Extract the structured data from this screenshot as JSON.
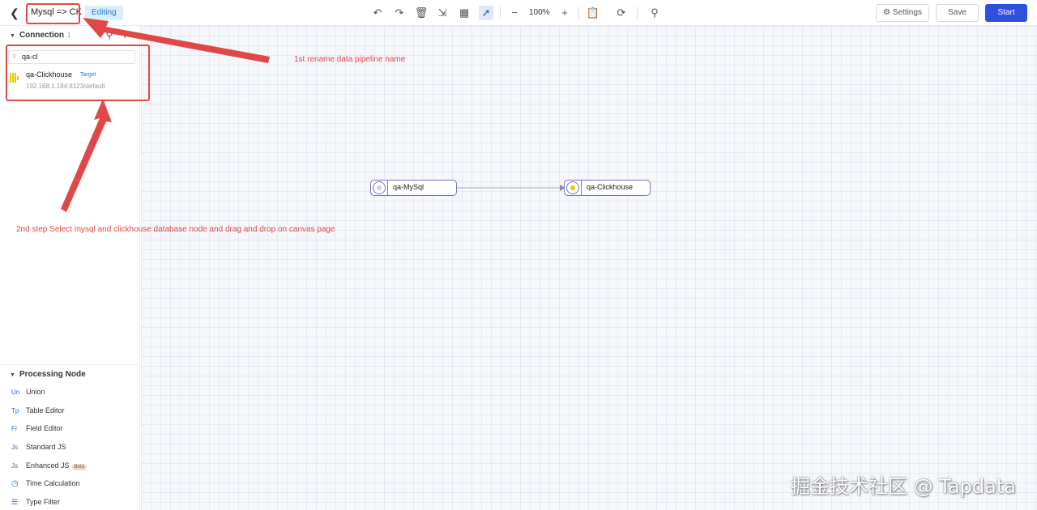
{
  "header": {
    "title": "Mysql => CK",
    "status": "Editing",
    "zoom": "100%",
    "settings_label": "Settings",
    "save_label": "Save",
    "start_label": "Start"
  },
  "sidebar": {
    "connection_heading": "Connection",
    "connection_count": "1",
    "search_value": "qa-cl",
    "connections": [
      {
        "name": "qa-Clickhouse",
        "tag": "Target",
        "address": "192.168.1.184:8123/default"
      }
    ],
    "processing_heading": "Processing Node",
    "processing_items": [
      {
        "icon": "Un",
        "label": "Union"
      },
      {
        "icon": "Tp",
        "label": "Table Editor"
      },
      {
        "icon": "Fr",
        "label": "Field Editor"
      },
      {
        "icon": "Js",
        "label": "Standard JS"
      },
      {
        "icon": "Js",
        "label": "Enhanced JS",
        "badge": "Beta"
      },
      {
        "icon": "clock-icon",
        "label": "Time Calculation"
      },
      {
        "icon": "filter-icon",
        "label": "Type Filter"
      }
    ]
  },
  "canvas": {
    "nodes": [
      {
        "label": "qa-MySql",
        "icon": "mysql-icon"
      },
      {
        "label": "qa-Clickhouse",
        "icon": "clickhouse-icon"
      }
    ]
  },
  "annotations": {
    "step1": "1st rename data pipeline name",
    "step2": "2nd step Select mysql and clickhouse database node and drag and drop on canvas page"
  },
  "watermark": "掘金技术社区 @ Tapdata",
  "colors": {
    "accent": "#2f4fdd",
    "annotation": "#e04848",
    "node_border": "#7d72c9",
    "clickhouse": "#f5c400"
  }
}
